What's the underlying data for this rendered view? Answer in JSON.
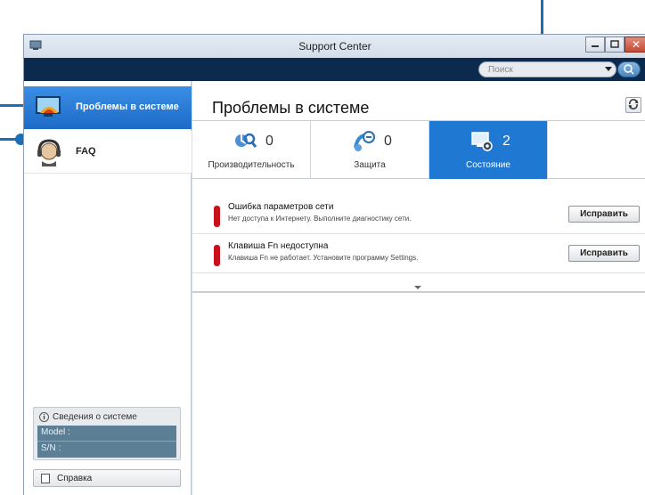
{
  "window": {
    "title": "Support Center"
  },
  "toolbar": {
    "search_placeholder": "Поиск"
  },
  "sidebar": {
    "items": [
      {
        "label": "Проблемы в системе",
        "icon": "monitor-warning-icon"
      },
      {
        "label": "FAQ",
        "icon": "headset-icon"
      }
    ],
    "system_info": {
      "heading": "Сведения о системе",
      "model": "Model :",
      "sn": "S/N :"
    },
    "help_label": "Справка"
  },
  "main": {
    "title": "Проблемы в системе",
    "tabs": [
      {
        "label": "Производительность",
        "count": "0",
        "icon": "performance-icon"
      },
      {
        "label": "Защита",
        "count": "0",
        "icon": "security-icon"
      },
      {
        "label": "Состояние",
        "count": "2",
        "icon": "status-icon"
      }
    ],
    "issues": [
      {
        "title": "Ошибка параметров сети",
        "description": "Нет доступа к Интернету. Выполните диагностику сети.",
        "button": "Исправить"
      },
      {
        "title": "Клавиша Fn недоступна",
        "description": "Клавиша Fn не работает. Установите программу Settings.",
        "button": "Исправить"
      }
    ]
  },
  "colors": {
    "accent": "#1f78d1",
    "toolbar": "#0c2a4d",
    "callout": "#1a6fb5",
    "error": "#c9111b"
  }
}
